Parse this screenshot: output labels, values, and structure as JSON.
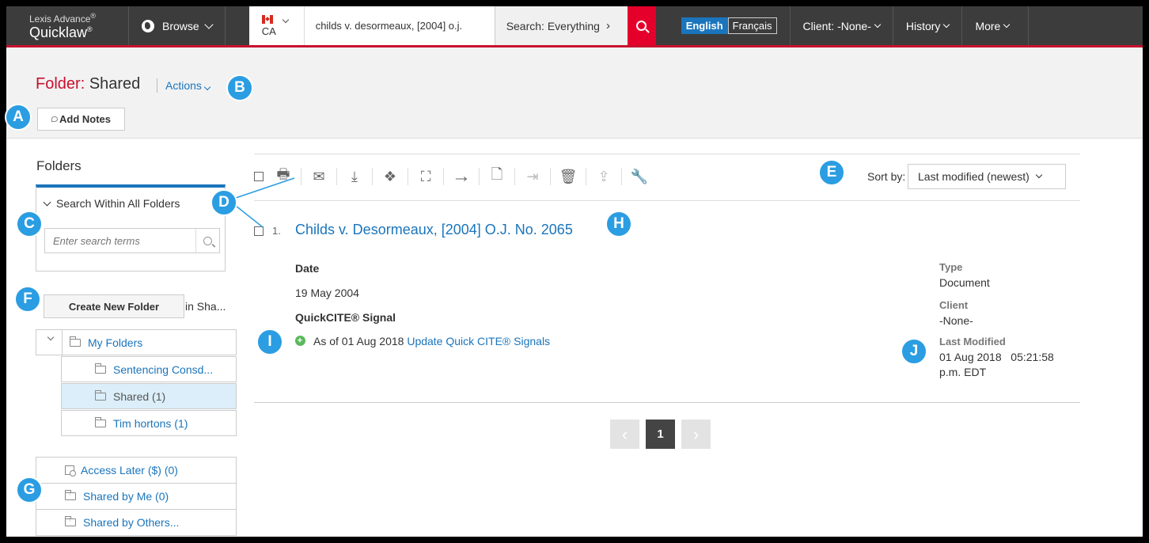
{
  "header": {
    "brand_line1": "Lexis Advance",
    "brand_line2": "Quicklaw",
    "reg": "®",
    "browse": "Browse",
    "jurisdiction": "CA",
    "search_value": "childs v. desormeaux, [2004] o.j.",
    "search_scope": "Search: Everything",
    "lang_en": "English",
    "lang_fr": "Français",
    "client": "Client: -None-",
    "history": "History",
    "more": "More"
  },
  "folder_header": {
    "label": "Folder:",
    "name": "Shared",
    "actions": "Actions",
    "add_notes": "Add Notes"
  },
  "sidebar": {
    "heading": "Folders",
    "search_within": "Search Within All Folders",
    "search_placeholder": "Enter search terms",
    "create_folder": "Create New Folder",
    "in_location": "in Sha...",
    "tree": {
      "root": "My Folders",
      "children": [
        "Sentencing Consd...",
        "Shared (1)",
        "Tim hortons (1)"
      ]
    },
    "other": [
      "Access Later ($) (0)",
      "Shared by Me (0)",
      "Shared by Others..."
    ]
  },
  "toolbar": {
    "sort_label": "Sort by:",
    "sort_value": "Last modified (newest)"
  },
  "result": {
    "number": "1.",
    "title": "Childs v. Desormeaux, [2004] O.J. No. 2065",
    "date_label": "Date",
    "date_value": "19 May 2004",
    "signal_label": "QuickCITE® Signal",
    "signal_text": "As of 01 Aug 2018",
    "signal_link": "Update Quick CITE® Signals",
    "type_label": "Type",
    "type_value": "Document",
    "client_label": "Client",
    "client_value": "-None-",
    "modified_label": "Last Modified",
    "modified_value_line1": "01 Aug 2018   05:21:58",
    "modified_value_line2": "p.m. EDT"
  },
  "pagination": {
    "current": "1",
    "prev": "‹",
    "next": "›"
  },
  "callouts": [
    "A",
    "B",
    "C",
    "D",
    "E",
    "F",
    "G",
    "H",
    "I",
    "J"
  ],
  "colors": {
    "accent_red": "#c8102e",
    "link_blue": "#1a75bc",
    "callout_blue": "#2b9de2",
    "nav_dark": "#3c3c3c"
  }
}
